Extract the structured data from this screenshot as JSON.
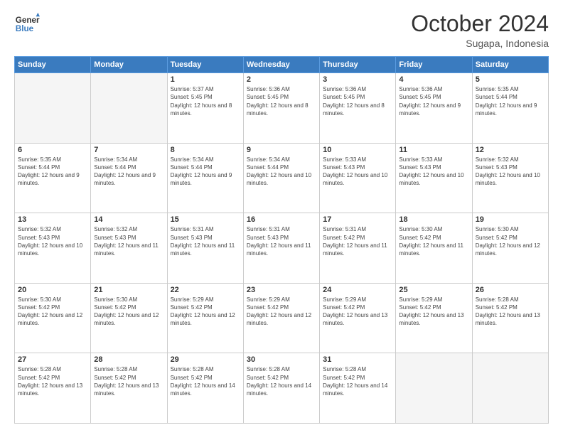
{
  "header": {
    "logo_line1": "General",
    "logo_line2": "Blue",
    "month": "October 2024",
    "location": "Sugapa, Indonesia"
  },
  "weekdays": [
    "Sunday",
    "Monday",
    "Tuesday",
    "Wednesday",
    "Thursday",
    "Friday",
    "Saturday"
  ],
  "weeks": [
    [
      {
        "day": "",
        "empty": true
      },
      {
        "day": "",
        "empty": true
      },
      {
        "day": "1",
        "sunrise": "Sunrise: 5:37 AM",
        "sunset": "Sunset: 5:45 PM",
        "daylight": "Daylight: 12 hours and 8 minutes."
      },
      {
        "day": "2",
        "sunrise": "Sunrise: 5:36 AM",
        "sunset": "Sunset: 5:45 PM",
        "daylight": "Daylight: 12 hours and 8 minutes."
      },
      {
        "day": "3",
        "sunrise": "Sunrise: 5:36 AM",
        "sunset": "Sunset: 5:45 PM",
        "daylight": "Daylight: 12 hours and 8 minutes."
      },
      {
        "day": "4",
        "sunrise": "Sunrise: 5:36 AM",
        "sunset": "Sunset: 5:45 PM",
        "daylight": "Daylight: 12 hours and 9 minutes."
      },
      {
        "day": "5",
        "sunrise": "Sunrise: 5:35 AM",
        "sunset": "Sunset: 5:44 PM",
        "daylight": "Daylight: 12 hours and 9 minutes."
      }
    ],
    [
      {
        "day": "6",
        "sunrise": "Sunrise: 5:35 AM",
        "sunset": "Sunset: 5:44 PM",
        "daylight": "Daylight: 12 hours and 9 minutes."
      },
      {
        "day": "7",
        "sunrise": "Sunrise: 5:34 AM",
        "sunset": "Sunset: 5:44 PM",
        "daylight": "Daylight: 12 hours and 9 minutes."
      },
      {
        "day": "8",
        "sunrise": "Sunrise: 5:34 AM",
        "sunset": "Sunset: 5:44 PM",
        "daylight": "Daylight: 12 hours and 9 minutes."
      },
      {
        "day": "9",
        "sunrise": "Sunrise: 5:34 AM",
        "sunset": "Sunset: 5:44 PM",
        "daylight": "Daylight: 12 hours and 10 minutes."
      },
      {
        "day": "10",
        "sunrise": "Sunrise: 5:33 AM",
        "sunset": "Sunset: 5:43 PM",
        "daylight": "Daylight: 12 hours and 10 minutes."
      },
      {
        "day": "11",
        "sunrise": "Sunrise: 5:33 AM",
        "sunset": "Sunset: 5:43 PM",
        "daylight": "Daylight: 12 hours and 10 minutes."
      },
      {
        "day": "12",
        "sunrise": "Sunrise: 5:32 AM",
        "sunset": "Sunset: 5:43 PM",
        "daylight": "Daylight: 12 hours and 10 minutes."
      }
    ],
    [
      {
        "day": "13",
        "sunrise": "Sunrise: 5:32 AM",
        "sunset": "Sunset: 5:43 PM",
        "daylight": "Daylight: 12 hours and 10 minutes."
      },
      {
        "day": "14",
        "sunrise": "Sunrise: 5:32 AM",
        "sunset": "Sunset: 5:43 PM",
        "daylight": "Daylight: 12 hours and 11 minutes."
      },
      {
        "day": "15",
        "sunrise": "Sunrise: 5:31 AM",
        "sunset": "Sunset: 5:43 PM",
        "daylight": "Daylight: 12 hours and 11 minutes."
      },
      {
        "day": "16",
        "sunrise": "Sunrise: 5:31 AM",
        "sunset": "Sunset: 5:43 PM",
        "daylight": "Daylight: 12 hours and 11 minutes."
      },
      {
        "day": "17",
        "sunrise": "Sunrise: 5:31 AM",
        "sunset": "Sunset: 5:42 PM",
        "daylight": "Daylight: 12 hours and 11 minutes."
      },
      {
        "day": "18",
        "sunrise": "Sunrise: 5:30 AM",
        "sunset": "Sunset: 5:42 PM",
        "daylight": "Daylight: 12 hours and 11 minutes."
      },
      {
        "day": "19",
        "sunrise": "Sunrise: 5:30 AM",
        "sunset": "Sunset: 5:42 PM",
        "daylight": "Daylight: 12 hours and 12 minutes."
      }
    ],
    [
      {
        "day": "20",
        "sunrise": "Sunrise: 5:30 AM",
        "sunset": "Sunset: 5:42 PM",
        "daylight": "Daylight: 12 hours and 12 minutes."
      },
      {
        "day": "21",
        "sunrise": "Sunrise: 5:30 AM",
        "sunset": "Sunset: 5:42 PM",
        "daylight": "Daylight: 12 hours and 12 minutes."
      },
      {
        "day": "22",
        "sunrise": "Sunrise: 5:29 AM",
        "sunset": "Sunset: 5:42 PM",
        "daylight": "Daylight: 12 hours and 12 minutes."
      },
      {
        "day": "23",
        "sunrise": "Sunrise: 5:29 AM",
        "sunset": "Sunset: 5:42 PM",
        "daylight": "Daylight: 12 hours and 12 minutes."
      },
      {
        "day": "24",
        "sunrise": "Sunrise: 5:29 AM",
        "sunset": "Sunset: 5:42 PM",
        "daylight": "Daylight: 12 hours and 13 minutes."
      },
      {
        "day": "25",
        "sunrise": "Sunrise: 5:29 AM",
        "sunset": "Sunset: 5:42 PM",
        "daylight": "Daylight: 12 hours and 13 minutes."
      },
      {
        "day": "26",
        "sunrise": "Sunrise: 5:28 AM",
        "sunset": "Sunset: 5:42 PM",
        "daylight": "Daylight: 12 hours and 13 minutes."
      }
    ],
    [
      {
        "day": "27",
        "sunrise": "Sunrise: 5:28 AM",
        "sunset": "Sunset: 5:42 PM",
        "daylight": "Daylight: 12 hours and 13 minutes."
      },
      {
        "day": "28",
        "sunrise": "Sunrise: 5:28 AM",
        "sunset": "Sunset: 5:42 PM",
        "daylight": "Daylight: 12 hours and 13 minutes."
      },
      {
        "day": "29",
        "sunrise": "Sunrise: 5:28 AM",
        "sunset": "Sunset: 5:42 PM",
        "daylight": "Daylight: 12 hours and 14 minutes."
      },
      {
        "day": "30",
        "sunrise": "Sunrise: 5:28 AM",
        "sunset": "Sunset: 5:42 PM",
        "daylight": "Daylight: 12 hours and 14 minutes."
      },
      {
        "day": "31",
        "sunrise": "Sunrise: 5:28 AM",
        "sunset": "Sunset: 5:42 PM",
        "daylight": "Daylight: 12 hours and 14 minutes."
      },
      {
        "day": "",
        "empty": true
      },
      {
        "day": "",
        "empty": true
      }
    ]
  ]
}
